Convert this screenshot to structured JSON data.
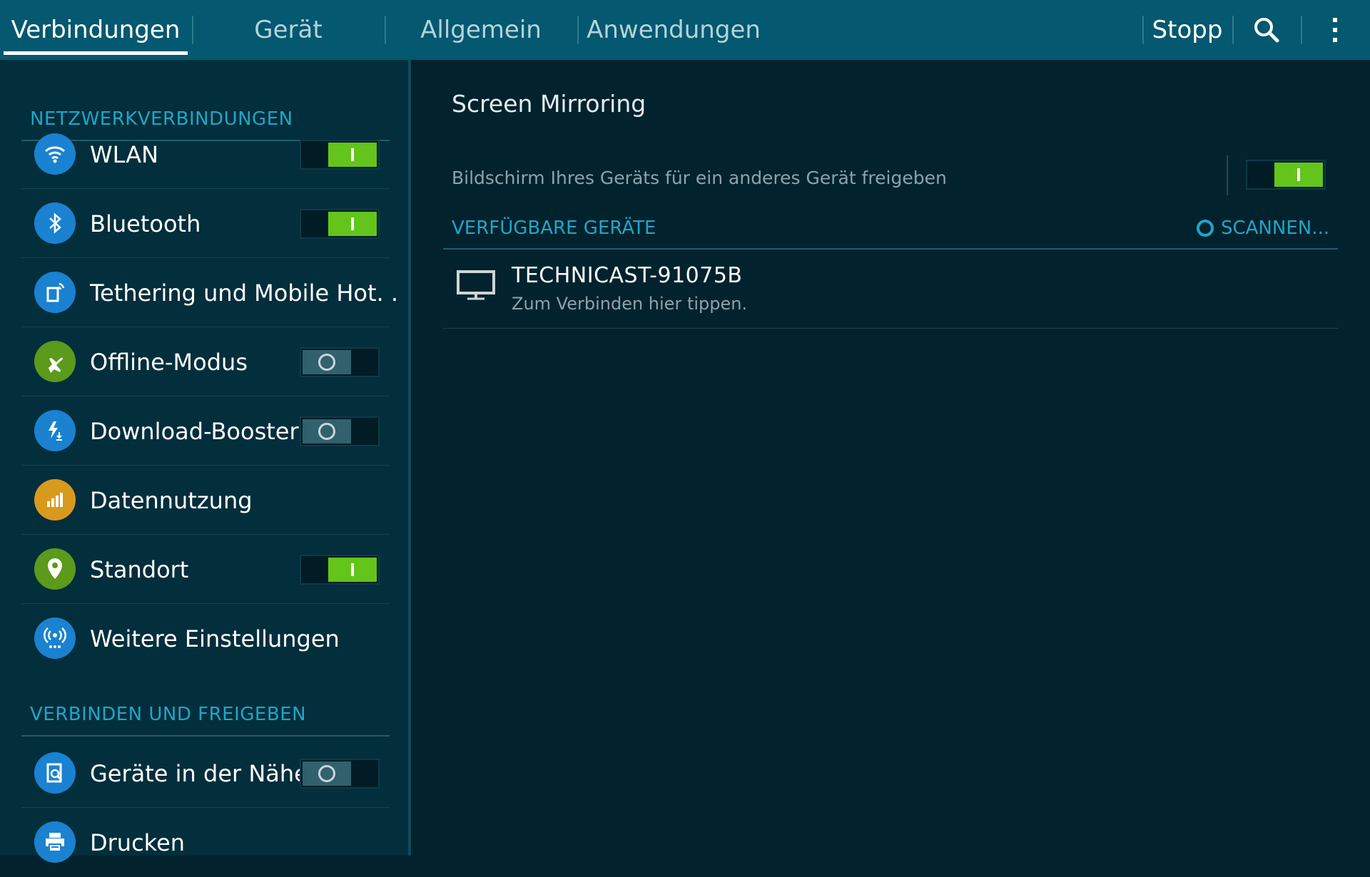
{
  "tabs": [
    {
      "label": "Verbindungen",
      "active": true
    },
    {
      "label": "Gerät",
      "active": false
    },
    {
      "label": "Allgemein",
      "active": false
    },
    {
      "label": "Anwendungen",
      "active": false
    }
  ],
  "actions": {
    "stop_label": "Stopp",
    "search_icon": "search-icon",
    "more_icon": "more-vertical-icon"
  },
  "sidebar": {
    "sections": [
      {
        "header": "NETZWERKVERBINDUNGEN",
        "items": [
          {
            "label": "WLAN",
            "icon": "wifi-icon",
            "icon_color": "#1a82d0",
            "switch": "on"
          },
          {
            "label": "Bluetooth",
            "icon": "bluetooth-icon",
            "icon_color": "#1a82d0",
            "switch": "on"
          },
          {
            "label": "Tethering und Mobile Hot. .",
            "icon": "tethering-icon",
            "icon_color": "#1a82d0",
            "switch": null
          },
          {
            "label": "Offline-Modus",
            "icon": "airplane-icon",
            "icon_color": "#5b9a1b",
            "switch": "off"
          },
          {
            "label": "Download-Booster",
            "icon": "download-booster-icon",
            "icon_color": "#1a82d0",
            "switch": "off"
          },
          {
            "label": "Datennutzung",
            "icon": "data-usage-icon",
            "icon_color": "#d89a1e",
            "switch": null
          },
          {
            "label": "Standort",
            "icon": "location-icon",
            "icon_color": "#5b9a1b",
            "switch": "on"
          },
          {
            "label": "Weitere Einstellungen",
            "icon": "more-networks-icon",
            "icon_color": "#1a82d0",
            "switch": null
          }
        ]
      },
      {
        "header": "VERBINDEN UND FREIGEBEN",
        "items": [
          {
            "label": "Geräte in der Nähe",
            "icon": "nearby-devices-icon",
            "icon_color": "#1a82d0",
            "switch": "off"
          },
          {
            "label": "Drucken",
            "icon": "printer-icon",
            "icon_color": "#1a82d0",
            "switch": null
          }
        ]
      }
    ]
  },
  "main": {
    "title": "Screen Mirroring",
    "description": "Bildschirm Ihres Geräts für ein anderes Gerät freigeben",
    "switch": "on",
    "devices_header": "VERFÜGBARE GERÄTE",
    "scan_label": "SCANNEN...",
    "devices": [
      {
        "name": "TECHNICAST-91075B",
        "subtitle": "Zum Verbinden hier tippen.",
        "icon": "monitor-icon"
      }
    ]
  },
  "colors": {
    "topbar": "#04586f",
    "sidebar": "#032e3c",
    "main_bg": "#02222d",
    "accent": "#1fa6c7",
    "switch_on": "#63c51b"
  }
}
